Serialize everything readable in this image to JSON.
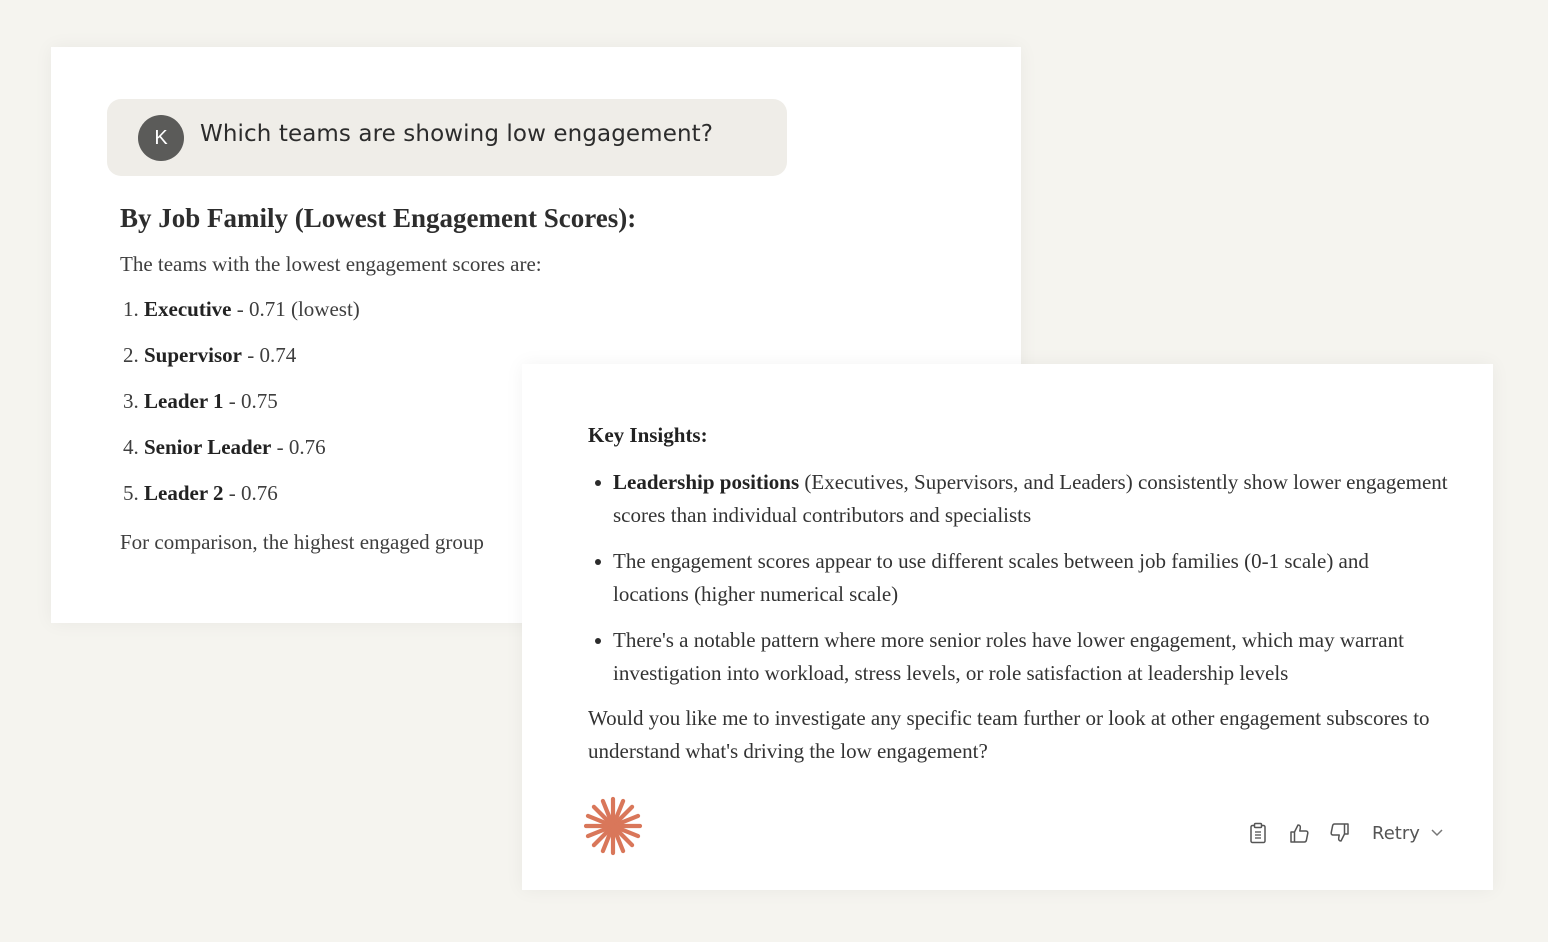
{
  "query": {
    "avatar_initial": "K",
    "text": "Which teams are showing low engagement?"
  },
  "response_top": {
    "heading": "By Job Family (Lowest Engagement Scores):",
    "intro": "The teams with the lowest engagement scores are:",
    "items": [
      {
        "num": "1.",
        "name": "Executive",
        "detail": " - 0.71 (lowest)"
      },
      {
        "num": "2.",
        "name": "Supervisor",
        "detail": " - 0.74"
      },
      {
        "num": "3.",
        "name": "Leader 1",
        "detail": " - 0.75"
      },
      {
        "num": "4.",
        "name": "Senior Leader",
        "detail": " - 0.76"
      },
      {
        "num": "5.",
        "name": "Leader 2",
        "detail": " - 0.76"
      }
    ],
    "comparison": "For comparison, the highest engaged group"
  },
  "response_bottom": {
    "insights_title": "Key Insights:",
    "bullets": [
      {
        "bold": "Leadership positions",
        "text": " (Executives, Supervisors, and Leaders) consistently show lower engagement scores than individual contributors and specialists"
      },
      {
        "bold": "",
        "text": "The engagement scores appear to use different scales between job families (0-1 scale) and locations (higher numerical scale)"
      },
      {
        "bold": "",
        "text": "There's a notable pattern where more senior roles have lower engagement, which may warrant investigation into workload, stress levels, or role satisfaction at leadership levels"
      }
    ],
    "followup": "Would you like me to investigate any specific team further or look at other engagement subscores to understand what's driving the low engagement?"
  },
  "actions": {
    "copy_icon": "clipboard-icon",
    "like_icon": "thumbs-up-icon",
    "dislike_icon": "thumbs-down-icon",
    "retry_label": "Retry",
    "dropdown_icon": "chevron-down-icon"
  },
  "colors": {
    "background": "#f5f4ef",
    "bubble": "#efede8",
    "avatar": "#5b5b59",
    "accent": "#d9775a"
  }
}
